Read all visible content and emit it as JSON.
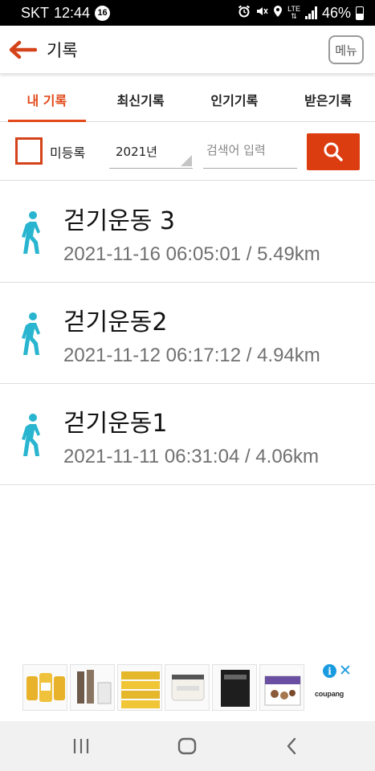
{
  "status_bar": {
    "carrier": "SKT",
    "time": "12:44",
    "notification_count": "16",
    "network": "LTE",
    "battery": "46%",
    "battery_level": 0.46
  },
  "app_bar": {
    "title": "기록",
    "menu_label": "메뉴"
  },
  "tabs": [
    {
      "label": "내 기록",
      "active": true
    },
    {
      "label": "최신기록",
      "active": false
    },
    {
      "label": "인기기록",
      "active": false
    },
    {
      "label": "받은기록",
      "active": false
    }
  ],
  "filters": {
    "unregistered_label": "미등록",
    "unregistered_checked": false,
    "year_value": "2021년",
    "search_placeholder": "검색어 입력"
  },
  "records": [
    {
      "title": "걷기운동 3",
      "datetime": "2021-11-16 06:05:01",
      "distance": "5.49km",
      "meta": "2021-11-16 06:05:01 / 5.49km",
      "icon": "walking-person-icon"
    },
    {
      "title": "걷기운동2",
      "datetime": "2021-11-12 06:17:12",
      "distance": "4.94km",
      "meta": "2021-11-12 06:17:12 / 4.94km",
      "icon": "walking-person-icon"
    },
    {
      "title": "걷기운동1",
      "datetime": "2021-11-11 06:31:04",
      "distance": "4.06km",
      "meta": "2021-11-11 06:31:04 / 4.06km",
      "icon": "walking-person-icon"
    }
  ],
  "ad": {
    "brand": "coupang",
    "product_count": 6
  },
  "colors": {
    "accent": "#e24a1b",
    "search_button": "#dc3d10",
    "walk_icon": "#29b5cf",
    "meta_text": "#707070"
  }
}
